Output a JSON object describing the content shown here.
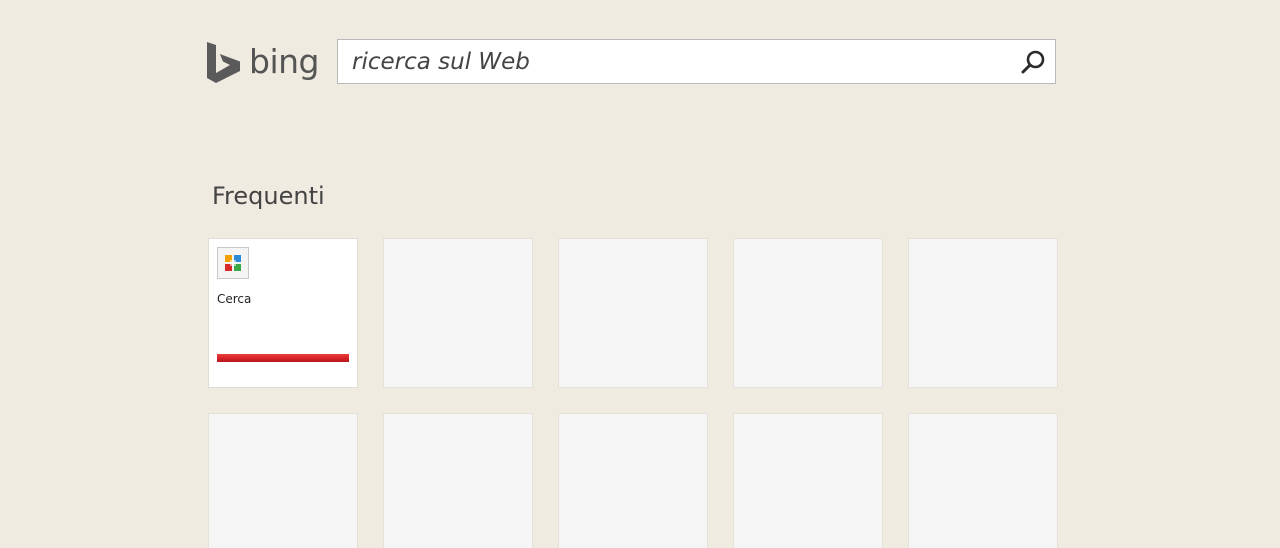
{
  "header": {
    "logo_text": "bing",
    "search": {
      "placeholder": "ricerca sul Web",
      "value": "",
      "button_icon": "search-icon"
    }
  },
  "frequent": {
    "title": "Frequenti",
    "tiles": [
      {
        "label": "Cerca",
        "icon": "app-grid-icon",
        "accent": "#d9232a"
      },
      {
        "label": ""
      },
      {
        "label": ""
      },
      {
        "label": ""
      },
      {
        "label": ""
      },
      {
        "label": ""
      },
      {
        "label": ""
      },
      {
        "label": ""
      },
      {
        "label": ""
      },
      {
        "label": ""
      }
    ]
  },
  "colors": {
    "background": "#f0ebe0",
    "logo": "#555555",
    "tile_empty": "#f5f5f5",
    "tile_filled": "#ffffff"
  }
}
